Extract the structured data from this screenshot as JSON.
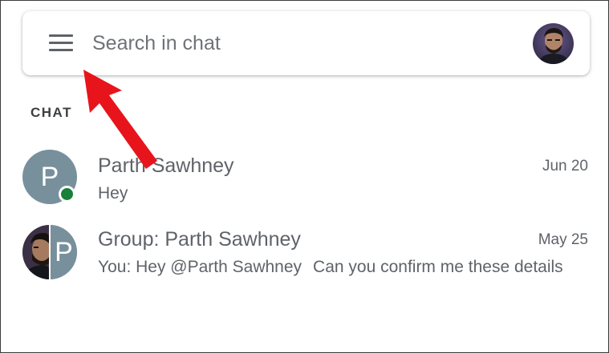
{
  "search": {
    "placeholder": "Search in chat"
  },
  "icons": {
    "menu": "hamburger-menu-icon",
    "account": "account-avatar-icon"
  },
  "section": {
    "label": "CHAT"
  },
  "chats": [
    {
      "avatar_letter": "P",
      "name": "Parth Sawhney",
      "date": "Jun 20",
      "snippet": "Hey",
      "online": true
    },
    {
      "avatar_letter": "P",
      "name": "Group: Parth Sawhney",
      "date": "May 25",
      "sender": "You: Hey @Parth Sawhney",
      "snippet": "Can you confirm me these details"
    }
  ],
  "colors": {
    "avatar_bg": "#78909c",
    "presence": "#188038",
    "text": "#5f6368",
    "arrow": "#e8141c"
  }
}
